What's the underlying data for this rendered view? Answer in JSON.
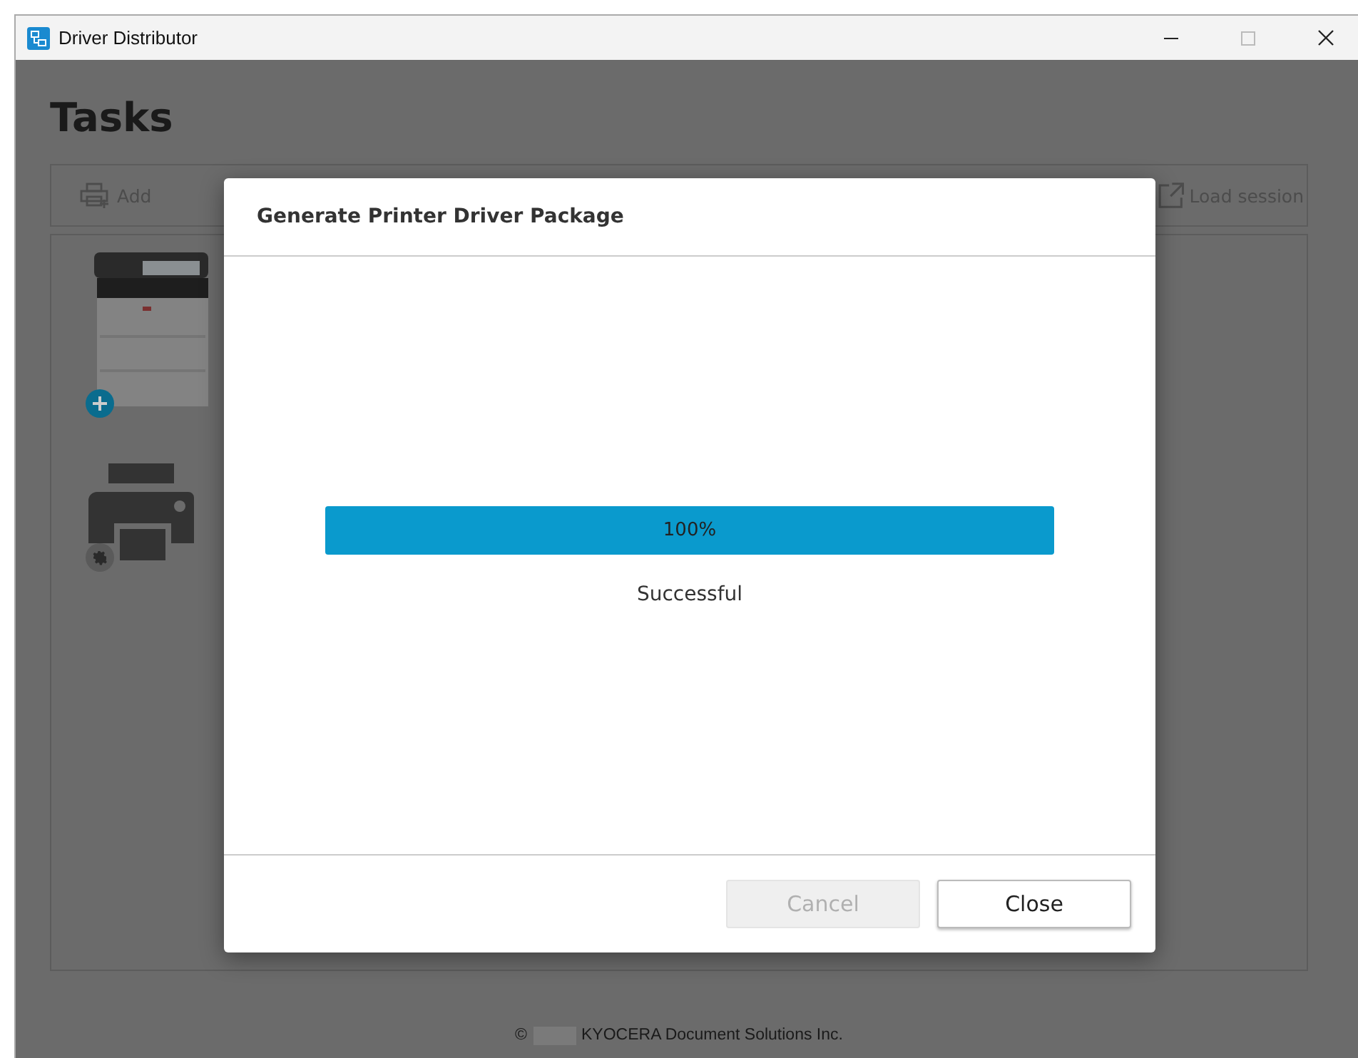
{
  "window": {
    "title": "Driver Distributor"
  },
  "page": {
    "title": "Tasks"
  },
  "toolbar": {
    "buttons": [
      {
        "label": "Add",
        "kind": "add"
      },
      {
        "label": "Load session",
        "kind": "load"
      }
    ]
  },
  "devices": [
    {
      "kind": "picture",
      "badge": {
        "kind": "add"
      }
    },
    {
      "kind": "generic",
      "badge": {
        "kind": "settings"
      }
    }
  ],
  "dialog": {
    "title": "Generate Printer Driver Package",
    "progress": {
      "level": 1,
      "reading": "100%"
    },
    "status": "Successful",
    "buttons": [
      {
        "label": "Cancel",
        "disabled": true
      },
      {
        "label": "Close",
        "disabled": false
      }
    ]
  },
  "footer": {
    "copyright": "©",
    "company": "KYOCERA Document Solutions Inc."
  }
}
